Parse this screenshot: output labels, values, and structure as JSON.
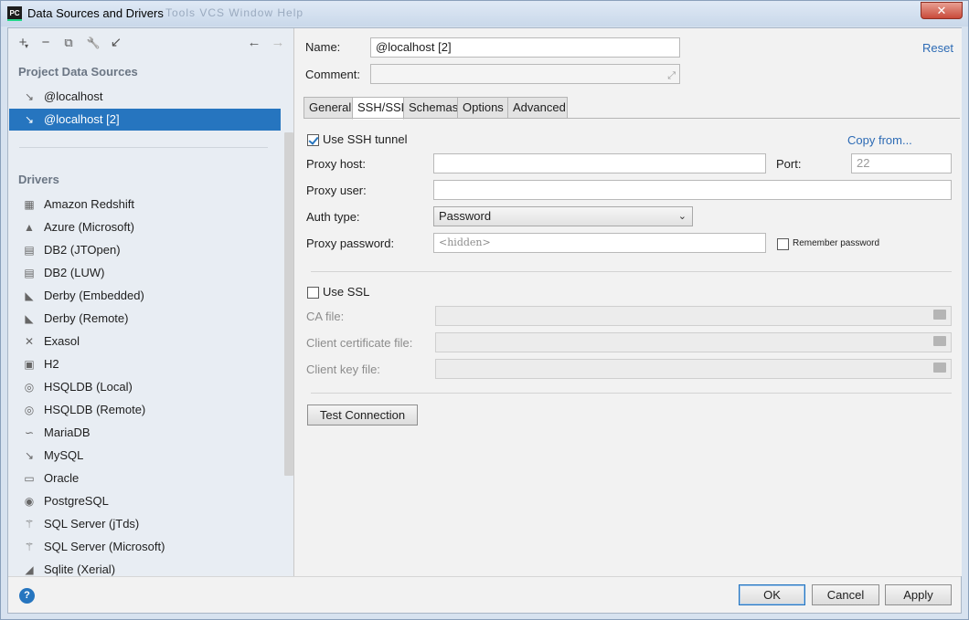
{
  "window": {
    "title": "Data Sources and Drivers",
    "app_badge": "PC",
    "ghost_menu": "Tools   VCS   Window   Help",
    "close_glyph": "✕"
  },
  "toolbar": {
    "add": "+",
    "add_arrow": "▾",
    "remove": "−",
    "duplicate": "⧉",
    "wrench": "🔧",
    "import": "↙",
    "back": "←",
    "forward": "→"
  },
  "project_sources": {
    "header": "Project Data Sources",
    "items": [
      {
        "label": "@localhost",
        "icon": "mysql-dolphin-icon",
        "selected": false
      },
      {
        "label": "@localhost [2]",
        "icon": "mysql-dolphin-icon",
        "selected": true
      }
    ]
  },
  "drivers": {
    "header": "Drivers",
    "items": [
      {
        "label": "Amazon Redshift",
        "glyph": "▦"
      },
      {
        "label": "Azure (Microsoft)",
        "glyph": "▲"
      },
      {
        "label": "DB2 (JTOpen)",
        "glyph": "▤"
      },
      {
        "label": "DB2 (LUW)",
        "glyph": "▤"
      },
      {
        "label": "Derby (Embedded)",
        "glyph": "◣"
      },
      {
        "label": "Derby (Remote)",
        "glyph": "◣"
      },
      {
        "label": "Exasol",
        "glyph": "✕"
      },
      {
        "label": "H2",
        "glyph": "▣"
      },
      {
        "label": "HSQLDB (Local)",
        "glyph": "◎"
      },
      {
        "label": "HSQLDB (Remote)",
        "glyph": "◎"
      },
      {
        "label": "MariaDB",
        "glyph": "∽"
      },
      {
        "label": "MySQL",
        "glyph": "↘"
      },
      {
        "label": "Oracle",
        "glyph": "▭"
      },
      {
        "label": "PostgreSQL",
        "glyph": "◉"
      },
      {
        "label": "SQL Server (jTds)",
        "glyph": "⚚"
      },
      {
        "label": "SQL Server (Microsoft)",
        "glyph": "⚚"
      },
      {
        "label": "Sqlite (Xerial)",
        "glyph": "◢"
      }
    ]
  },
  "form": {
    "name_label": "Name:",
    "name_value": "@localhost [2]",
    "comment_label": "Comment:",
    "comment_value": "",
    "reset": "Reset",
    "expand_glyph": "⤢"
  },
  "tabs": [
    "General",
    "SSH/SSL",
    "Schemas",
    "Options",
    "Advanced"
  ],
  "active_tab": "SSH/SSL",
  "ssh": {
    "use_ssh_label": "Use SSH tunnel",
    "use_ssh_checked": true,
    "copy_from": "Copy from...",
    "proxy_host_label": "Proxy host:",
    "proxy_host_value": "",
    "port_label": "Port:",
    "port_value": "22",
    "proxy_user_label": "Proxy user:",
    "proxy_user_value": "",
    "auth_type_label": "Auth type:",
    "auth_type_value": "Password",
    "chevron": "⌄",
    "proxy_password_label": "Proxy password:",
    "proxy_password_value": "<hidden>",
    "remember_password_label": "Remember password",
    "remember_password_checked": false
  },
  "ssl": {
    "use_ssl_label": "Use SSL",
    "use_ssl_checked": false,
    "ca_file_label": "CA file:",
    "client_cert_label": "Client certificate file:",
    "client_key_label": "Client key file:"
  },
  "buttons": {
    "test_connection": "Test Connection",
    "ok": "OK",
    "cancel": "Cancel",
    "apply": "Apply",
    "help": "?"
  },
  "colors": {
    "selection": "#2675bf",
    "link": "#2d6bb5",
    "close": "#c94a3a"
  }
}
